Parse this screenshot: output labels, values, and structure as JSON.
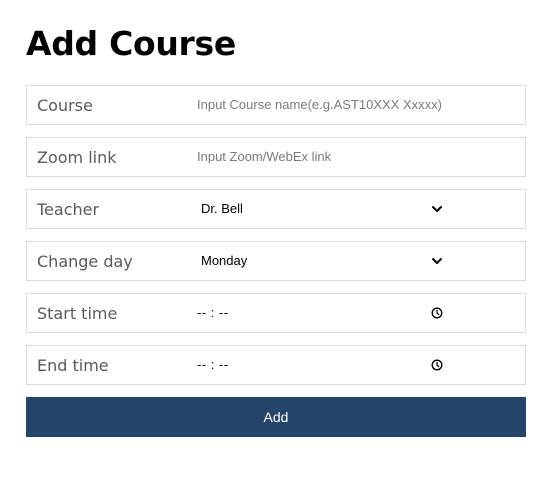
{
  "page": {
    "title": "Add Course"
  },
  "form": {
    "course": {
      "label": "Course",
      "placeholder": "Input Course name(e.g.AST10XXX Xxxxx)"
    },
    "zoom_link": {
      "label": "Zoom link",
      "placeholder": "Input Zoom/WebEx link"
    },
    "teacher": {
      "label": "Teacher",
      "selected": "Dr. Bell",
      "icon": "chevron-down-icon"
    },
    "change_day": {
      "label": "Change day",
      "selected": "Monday",
      "icon": "chevron-down-icon"
    },
    "start_time": {
      "label": "Start time",
      "value": "-- : --",
      "icon": "clock-icon"
    },
    "end_time": {
      "label": "End time",
      "value": "-- : --",
      "icon": "clock-icon"
    }
  },
  "actions": {
    "add_label": "Add"
  },
  "colors": {
    "button_bg": "#24446a",
    "button_text": "#ffffff",
    "border": "#dcdcdc",
    "label_text": "#5a5a5a",
    "placeholder_text": "#7a7a7a"
  }
}
